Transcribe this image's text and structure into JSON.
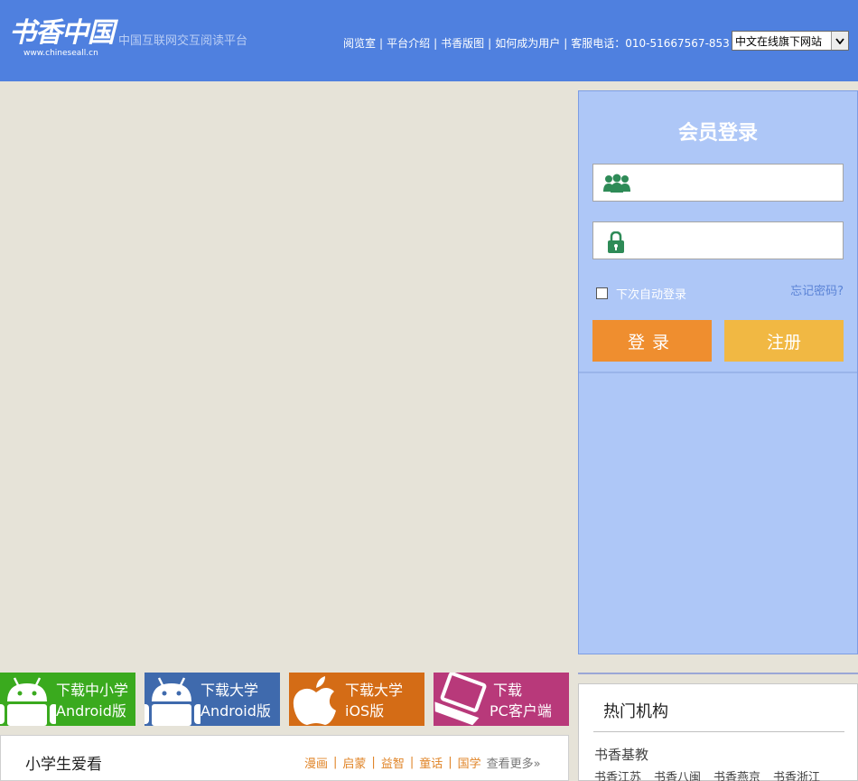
{
  "header": {
    "logo_text": "书香中国",
    "logo_url": "www.chineseall.cn",
    "tagline": "中国互联网交互阅读平台",
    "nav": [
      "阅览室",
      "平台介绍",
      "书香版图",
      "如何成为用户",
      "客服电话：010-51667567-853"
    ],
    "site_select": "中文在线旗下网站"
  },
  "login": {
    "title": "会员登录",
    "username_icon": "users-icon",
    "password_icon": "lock-icon",
    "remember_label": "下次自动登录",
    "forgot_label": "忘记密码?",
    "login_button": "登录",
    "register_button": "注册"
  },
  "downloads": [
    {
      "line1": "下载中小学",
      "line2": "Android版",
      "icon": "android-icon",
      "color": "#3aaa1e"
    },
    {
      "line1": "下载大学",
      "line2": "Android版",
      "icon": "android-icon",
      "color": "#3f6aad"
    },
    {
      "line1": "下载大学",
      "line2": "iOS版",
      "icon": "apple-icon",
      "color": "#d46c16"
    },
    {
      "line1": "下载",
      "line2": "PC客户端",
      "icon": "laptop-icon",
      "color": "#b8397a"
    }
  ],
  "hot_orgs": {
    "title": "热门机构",
    "first": "书香基教",
    "row": [
      "书香江苏",
      "书香八闽",
      "书香燕京",
      "书香浙江"
    ]
  },
  "kids": {
    "title": "小学生爱看",
    "tags": [
      "漫画",
      "启蒙",
      "益智",
      "童话",
      "国学"
    ],
    "more": "查看更多»"
  }
}
